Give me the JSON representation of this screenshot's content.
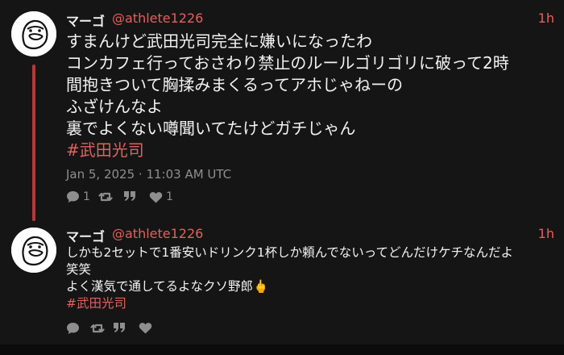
{
  "posts": [
    {
      "author": {
        "name": "マーゴ",
        "handle": "@athlete1226"
      },
      "time": "1h",
      "lines": [
        "すまんけど武田光司完全に嫌いになったわ",
        "コンカフェ行っておさわり禁止のルールゴリゴリに破って2時",
        "間抱きついて胸揉みまくるってアホじゃねーの",
        "ふざけんなよ",
        "裏でよくない噂聞いてたけどガチじゃん"
      ],
      "hashtag": "#武田光司",
      "timestamp": "Jan 5, 2025 · 11:03 AM UTC",
      "actions": {
        "reply_count": "1",
        "like_count": "1"
      }
    },
    {
      "author": {
        "name": "マーゴ",
        "handle": "@athlete1226"
      },
      "time": "1h",
      "lines": [
        "しかも2セットで1番安いドリンク1杯しか頼んでないってどんだけケチなんだよ",
        "笑笑",
        "よく漢気で通してるよなクソ野郎🖕"
      ],
      "hashtag": "#武田光司",
      "actions": {
        "reply_count": "",
        "like_count": ""
      }
    }
  ],
  "colors": {
    "accent": "#e0625d",
    "thread": "#b33a3a",
    "background": "#151515",
    "muted": "#8e8e8e"
  },
  "icons": [
    "avatar-doodle",
    "reply-icon",
    "retweet-icon",
    "quote-icon",
    "heart-icon"
  ]
}
